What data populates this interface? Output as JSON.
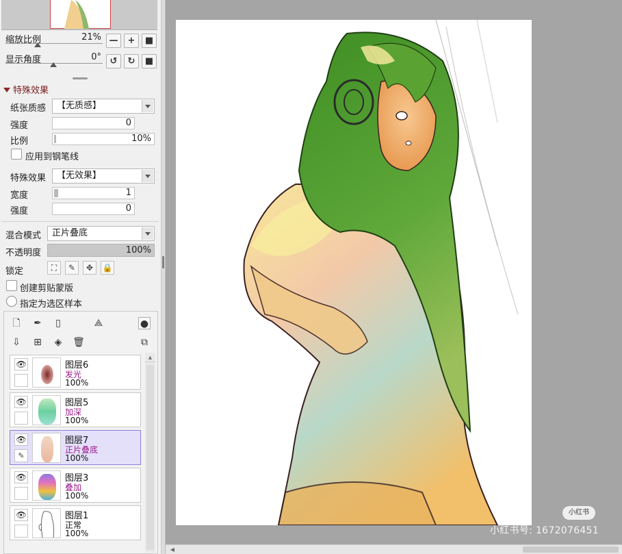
{
  "navigator": {
    "zoom_label": "缩放比例",
    "zoom_value": "21%",
    "zoom_level": 0.21,
    "rotate_label": "显示角度",
    "rotate_value": "0°",
    "zoom_buttons": [
      "minus-icon",
      "plus-icon",
      "reset-square-icon"
    ],
    "rotate_buttons": [
      "rotate-ccw-icon",
      "rotate-cw-icon",
      "reset-square-icon"
    ]
  },
  "effects": {
    "section_title": "特殊效果",
    "paper_texture_label": "纸张质感",
    "paper_texture_value": "【无质感】",
    "strength_label": "强度",
    "strength_value": "0",
    "scale_label": "比例",
    "scale_value": "10%",
    "scale_level": 0.1,
    "apply_pen_label": "应用到钢笔线",
    "apply_pen_checked": false,
    "effect_label": "特殊效果",
    "effect_value": "【无效果】",
    "width_label": "宽度",
    "width_value": "1",
    "strength2_label": "强度",
    "strength2_value": "0"
  },
  "layer_props": {
    "blend_label": "混合模式",
    "blend_value": "正片叠底",
    "opacity_label": "不透明度",
    "opacity_value": "100%",
    "opacity_level": 1.0,
    "lock_label": "锁定",
    "lock_icons": [
      "lock-transparency-icon",
      "lock-paint-icon",
      "lock-move-icon",
      "lock-all-icon"
    ],
    "clipping_label": "创建剪贴蒙版",
    "clipping_checked": false,
    "selection_source_label": "指定为选区样本",
    "selection_source_checked": false
  },
  "layer_tools": {
    "row1": [
      "new-layer-icon",
      "new-linework-layer-icon",
      "new-folder-icon",
      "tone-icon",
      "record-icon"
    ],
    "row2": [
      "merge-down-icon",
      "add-mask-icon",
      "clear-layer-icon",
      "trash-icon",
      "layer-settings-icon"
    ]
  },
  "layers": [
    {
      "name": "图层6",
      "blend": "发光",
      "opacity": "100%",
      "selected": false
    },
    {
      "name": "图层5",
      "blend": "加深",
      "opacity": "100%",
      "selected": false
    },
    {
      "name": "图层7",
      "blend": "正片叠底",
      "opacity": "100%",
      "selected": true
    },
    {
      "name": "图层3",
      "blend": "叠加",
      "opacity": "100%",
      "selected": false
    },
    {
      "name": "图层1",
      "blend": "正常",
      "opacity": "100%",
      "selected": false
    }
  ],
  "watermark": {
    "badge": "小红书",
    "text": "小红书号: 1672076451"
  },
  "colors": {
    "hair": "#4f9a2c",
    "skin": "#f2b070",
    "shirt_light": "#f3e6a0",
    "shirt_cool": "#a7d0c8",
    "line": "#3a2020"
  }
}
